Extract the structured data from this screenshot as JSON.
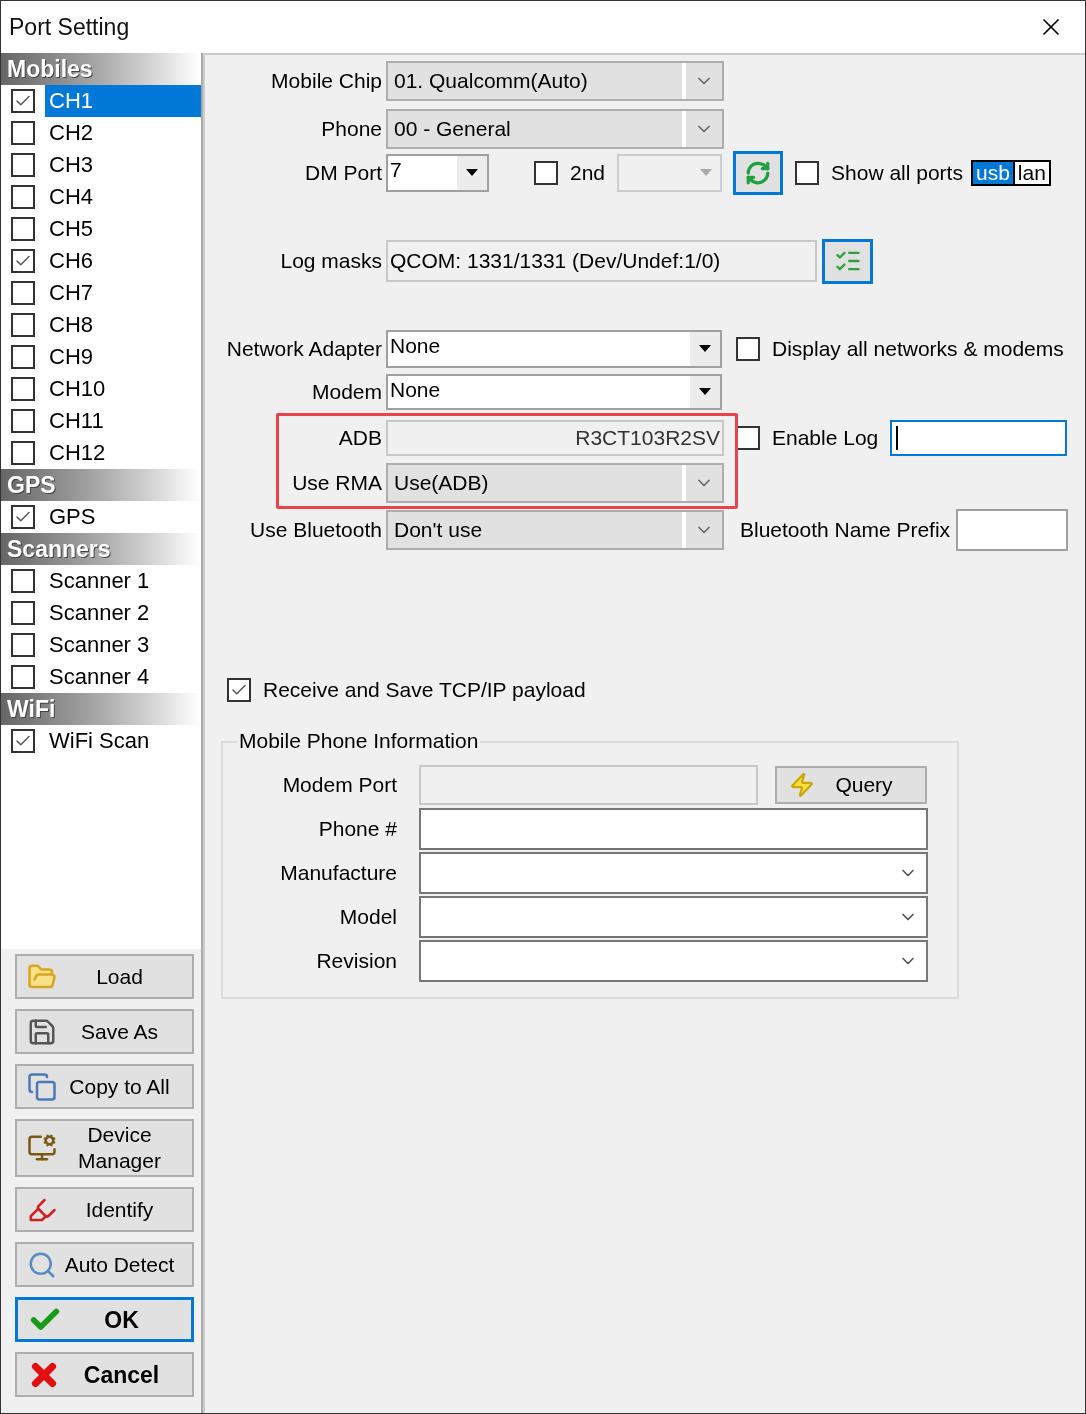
{
  "window": {
    "title": "Port Setting"
  },
  "sidebar": {
    "sections": [
      {
        "title": "Mobiles",
        "items": [
          {
            "label": "CH1",
            "checked": true,
            "selected": true
          },
          {
            "label": "CH2",
            "checked": false,
            "selected": false
          },
          {
            "label": "CH3",
            "checked": false,
            "selected": false
          },
          {
            "label": "CH4",
            "checked": false,
            "selected": false
          },
          {
            "label": "CH5",
            "checked": false,
            "selected": false
          },
          {
            "label": "CH6",
            "checked": true,
            "selected": false
          },
          {
            "label": "CH7",
            "checked": false,
            "selected": false
          },
          {
            "label": "CH8",
            "checked": false,
            "selected": false
          },
          {
            "label": "CH9",
            "checked": false,
            "selected": false
          },
          {
            "label": "CH10",
            "checked": false,
            "selected": false
          },
          {
            "label": "CH11",
            "checked": false,
            "selected": false
          },
          {
            "label": "CH12",
            "checked": false,
            "selected": false
          }
        ]
      },
      {
        "title": "GPS",
        "items": [
          {
            "label": "GPS",
            "checked": true,
            "selected": false
          }
        ]
      },
      {
        "title": "Scanners",
        "items": [
          {
            "label": "Scanner 1",
            "checked": false,
            "selected": false
          },
          {
            "label": "Scanner 2",
            "checked": false,
            "selected": false
          },
          {
            "label": "Scanner 3",
            "checked": false,
            "selected": false
          },
          {
            "label": "Scanner 4",
            "checked": false,
            "selected": false
          }
        ]
      },
      {
        "title": "WiFi",
        "items": [
          {
            "label": "WiFi Scan",
            "checked": true,
            "selected": false
          }
        ]
      }
    ]
  },
  "buttons": [
    {
      "kind": "load",
      "label": "Load",
      "default": false
    },
    {
      "kind": "save",
      "label": "Save As",
      "default": false
    },
    {
      "kind": "copy",
      "label": "Copy to All",
      "default": false
    },
    {
      "kind": "device",
      "label": "Device Manager",
      "default": false
    },
    {
      "kind": "identify",
      "label": "Identify",
      "default": false
    },
    {
      "kind": "detect",
      "label": "Auto Detect",
      "default": false
    },
    {
      "kind": "ok",
      "label": "OK",
      "default": true
    },
    {
      "kind": "cancel",
      "label": "Cancel",
      "default": false
    }
  ],
  "form": {
    "mobile_chip": {
      "label": "Mobile Chip",
      "value": "01. Qualcomm(Auto)"
    },
    "phone": {
      "label": "Phone",
      "value": "00 - General"
    },
    "dm_port": {
      "label": "DM Port",
      "value": "7"
    },
    "second": {
      "label": "2nd",
      "checked": false,
      "disabled": true
    },
    "show_all_ports": {
      "label": "Show all ports",
      "checked": false
    },
    "port_types": [
      {
        "label": "usb",
        "selected": true
      },
      {
        "label": "lan",
        "selected": false
      }
    ],
    "log_masks": {
      "label": "Log masks",
      "value": "QCOM: 1331/1331 (Dev/Undef:1/0)"
    },
    "network_adapter": {
      "label": "Network Adapter",
      "value": "None"
    },
    "display_all_networks": {
      "label": "Display all networks & modems",
      "checked": false
    },
    "modem": {
      "label": "Modem",
      "value": "None"
    },
    "adb": {
      "label": "ADB",
      "value": "R3CT103R2SV"
    },
    "enable_log": {
      "label": "Enable Log",
      "checked": false
    },
    "use_rma": {
      "label": "Use RMA",
      "value": "Use(ADB)"
    },
    "use_bluetooth": {
      "label": "Use Bluetooth",
      "value": "Don't use"
    },
    "bluetooth_name_prefix": {
      "label": "Bluetooth Name Prefix"
    },
    "receive_tcp": {
      "label": "Receive and Save TCP/IP payload",
      "checked": true
    }
  },
  "phone_info": {
    "title": "Mobile Phone Information",
    "query_button": "Query",
    "rows": [
      {
        "label": "Modem Port",
        "kind": "readonly"
      },
      {
        "label": "Phone #",
        "kind": "field"
      },
      {
        "label": "Manufacture",
        "kind": "combo"
      },
      {
        "label": "Model",
        "kind": "combo"
      },
      {
        "label": "Revision",
        "kind": "combo"
      }
    ]
  }
}
